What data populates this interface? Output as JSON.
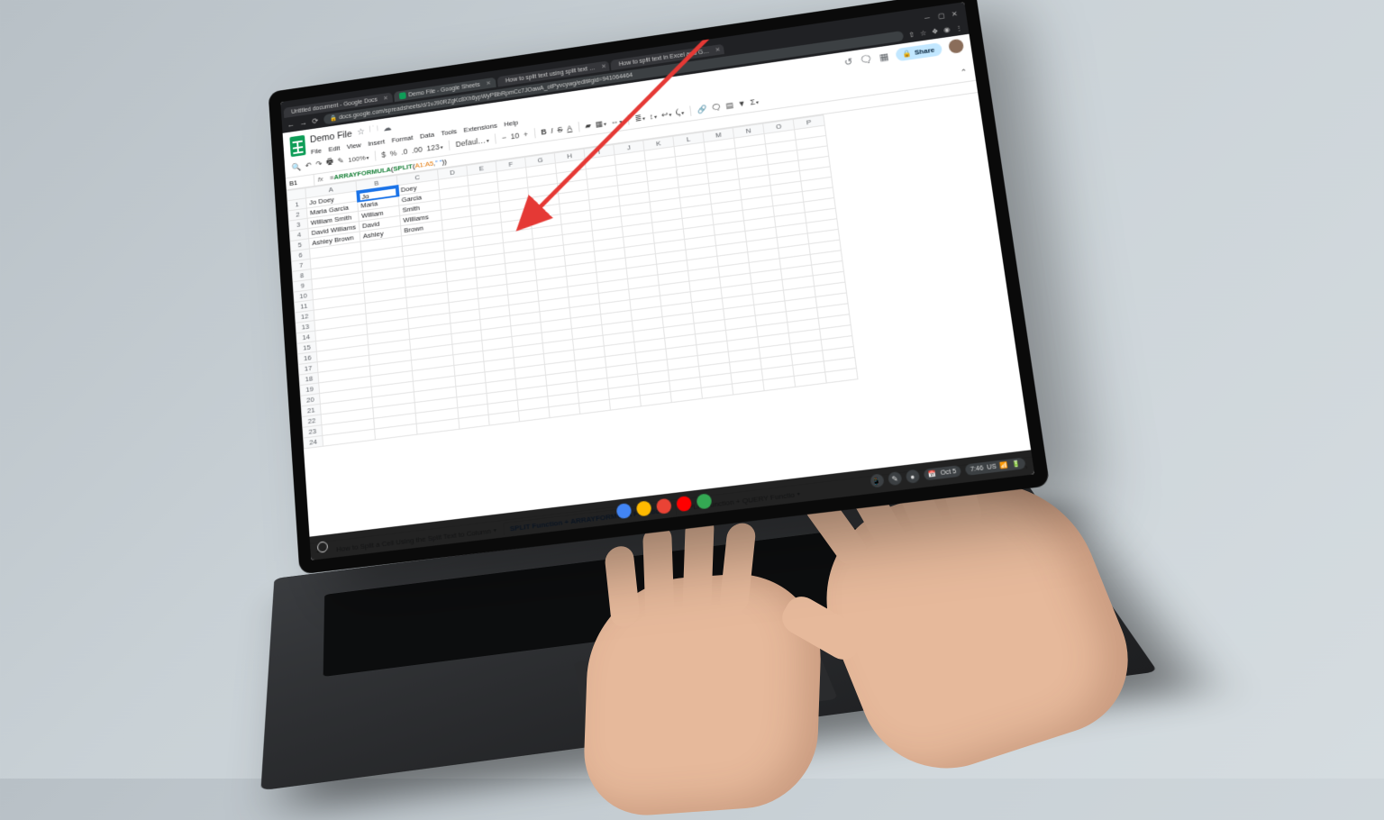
{
  "browser": {
    "tabs": [
      {
        "label": "Untitled document - Google Docs",
        "icon": "#4285f4"
      },
      {
        "label": "Demo File - Google Sheets",
        "icon": "#0f9d58",
        "active": true
      },
      {
        "label": "How to split text using split text …",
        "icon": "#ff6d01"
      },
      {
        "label": "How to split text in Excel and G…",
        "icon": "#ff6d01"
      }
    ],
    "url": "docs.google.com/spreadsheets/d/1vJ90RZgKc8Xh6ypWyPBbRpmCc7JOawA_otPyvcywg/edit#gid=941064464"
  },
  "doc": {
    "title": "Demo File",
    "menus": [
      "File",
      "Edit",
      "View",
      "Insert",
      "Format",
      "Data",
      "Tools",
      "Extensions",
      "Help"
    ],
    "share": "Share",
    "toolbar": {
      "zoom": "100%",
      "font": "Defaul…",
      "fontsize": "10"
    }
  },
  "formula": {
    "cell_ref": "B1",
    "prefix": "=",
    "fn1": "ARRAYFORMULA",
    "fn2": "SPLIT",
    "range": "A1:A5",
    "delim": "\" \"",
    "display": "=ARRAYFORMULA(SPLIT(A1:A5,\" \"))"
  },
  "inline_edit": {
    "value": "Jo"
  },
  "columns": [
    "A",
    "B",
    "C",
    "D",
    "E",
    "F",
    "G",
    "H",
    "I",
    "J",
    "K",
    "L",
    "M",
    "N",
    "O",
    "P"
  ],
  "rows": [
    {
      "n": 1,
      "A": "Jo Doey",
      "B": "",
      "C": "Doey"
    },
    {
      "n": 2,
      "A": "Maria Garcia",
      "B": "Maria",
      "C": "Garcia"
    },
    {
      "n": 3,
      "A": "William Smith",
      "B": "William",
      "C": "Smith"
    },
    {
      "n": 4,
      "A": "David Williams",
      "B": "David",
      "C": "Williams"
    },
    {
      "n": 5,
      "A": "Ashley Brown",
      "B": "Ashley",
      "C": "Brown"
    }
  ],
  "blank_row_count": 19,
  "sheet_tabs": {
    "plus": "+",
    "tabs": [
      {
        "label": "How to Split a Cell Using the Split Text to Column"
      },
      {
        "label": "SPLIT Function + ARRAYFORMULA Function",
        "active": true
      },
      {
        "label": "SPLIT Function + QUERY Functio"
      }
    ]
  },
  "shelf": {
    "apps": [
      {
        "name": "files",
        "color": "#4285f4"
      },
      {
        "name": "drive",
        "color": "#ffba00"
      },
      {
        "name": "chrome",
        "color": "#ea4335"
      },
      {
        "name": "youtube",
        "color": "#ff0000"
      },
      {
        "name": "messages",
        "color": "#34a853"
      }
    ],
    "date": "Oct 5",
    "time": "7:46",
    "locale": "US"
  }
}
